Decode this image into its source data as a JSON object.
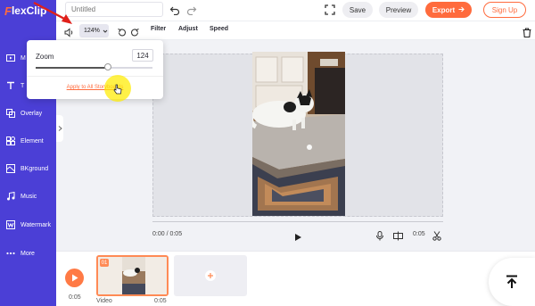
{
  "app": {
    "logo_mark": "F",
    "logo_text": "lexClip"
  },
  "sidebar": {
    "items": [
      {
        "label": "M",
        "icon": "media-icon"
      },
      {
        "label": "T",
        "icon": "text-icon"
      },
      {
        "label": "Overlay",
        "icon": "overlay-icon"
      },
      {
        "label": "Element",
        "icon": "element-icon"
      },
      {
        "label": "BKground",
        "icon": "background-icon"
      },
      {
        "label": "Music",
        "icon": "music-icon"
      },
      {
        "label": "Watermark",
        "icon": "watermark-icon"
      },
      {
        "label": "More",
        "icon": "more-icon"
      }
    ]
  },
  "topbar": {
    "title_placeholder": "Untitled",
    "save_label": "Save",
    "preview_label": "Preview",
    "export_label": "Export",
    "signup_label": "Sign Up"
  },
  "toolbar": {
    "zoom_value": "124%",
    "filter_label": "Filter",
    "adjust_label": "Adjust",
    "speed_label": "Speed"
  },
  "zoom_popup": {
    "label": "Zoom",
    "value": "124",
    "slider_fraction": 0.62,
    "apply_label": "Apply to All Storyboards"
  },
  "player": {
    "current_time": "0:00 / 0:05",
    "duration": "0:05"
  },
  "timeline": {
    "duration": "0:05",
    "clip_number": "01",
    "clip_name": "Video",
    "clip_duration": "0:05"
  },
  "colors": {
    "brand": "#4b3fd6",
    "accent": "#ff6b3d",
    "highlight": "#ffeb00",
    "annotation": "#e0201a"
  }
}
